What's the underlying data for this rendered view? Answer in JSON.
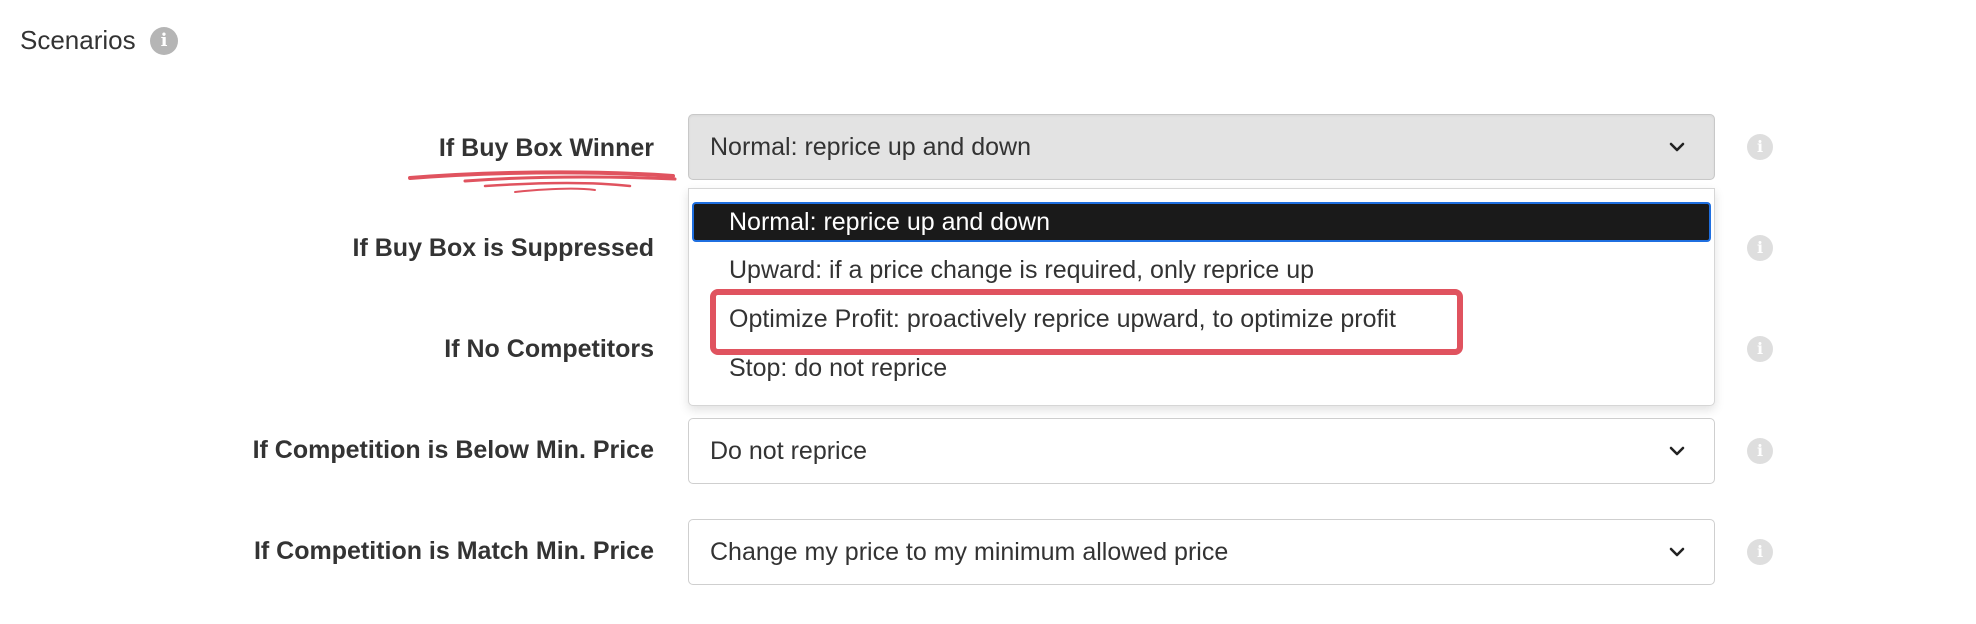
{
  "section": {
    "title": "Scenarios",
    "info_icon": "info-icon"
  },
  "rows": [
    {
      "label": "If Buy Box Winner",
      "value": "Normal: reprice up and down",
      "open": true
    },
    {
      "label": "If Buy Box is Suppressed",
      "value": ""
    },
    {
      "label": "If No Competitors",
      "value": ""
    },
    {
      "label": "If Competition is Below Min. Price",
      "value": "Do not reprice"
    },
    {
      "label": "If Competition is Match Min. Price",
      "value": "Change my price to my minimum allowed price"
    }
  ],
  "dropdown": {
    "options": [
      "Normal: reprice up and down",
      "Upward: if a price change is required, only reprice up",
      "Optimize Profit: proactively reprice upward, to optimize profit",
      "Stop: do not reprice"
    ],
    "selected_index": 0,
    "highlighted_index": 2
  },
  "colors": {
    "annotation": "#e0535f",
    "selected_bg": "#1a1a1a",
    "focus_border": "#1f6fe0"
  }
}
